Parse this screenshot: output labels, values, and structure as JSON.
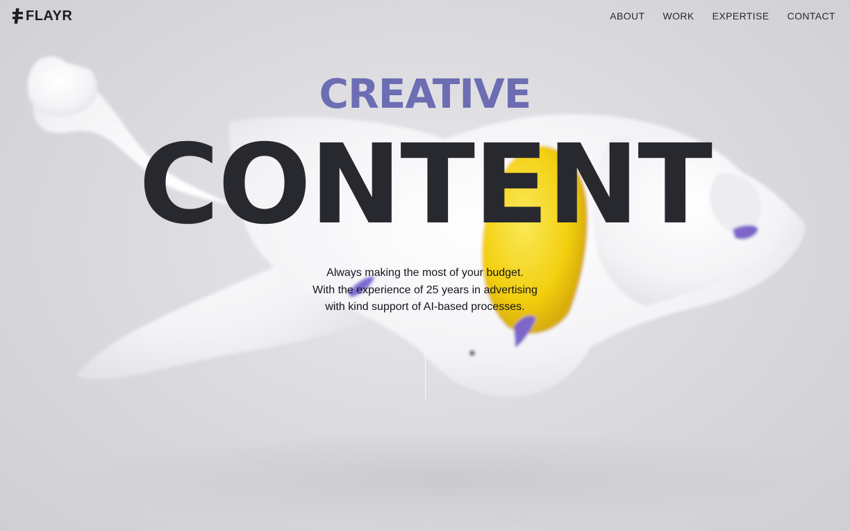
{
  "brand": {
    "name": "FLAYR",
    "icon": "flayr-mark-icon"
  },
  "nav": {
    "items": [
      {
        "label": "ABOUT"
      },
      {
        "label": "WORK"
      },
      {
        "label": "EXPERTISE"
      },
      {
        "label": "CONTACT"
      }
    ]
  },
  "hero": {
    "eyebrow": "CREATIVE",
    "title": "CONTENT",
    "tagline": [
      "Always making the most of your budget.",
      "With the experience of 25 years in advertising",
      "with kind support of AI-based processes."
    ]
  },
  "colors": {
    "accent": "#6c6db3",
    "headline": "#28292f",
    "background": "#d7d7da",
    "sculpture_highlight": "#f2d21f"
  }
}
